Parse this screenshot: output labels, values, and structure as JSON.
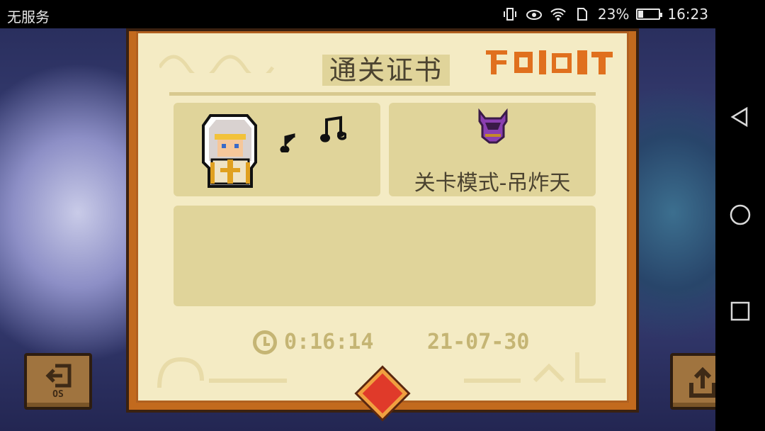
{
  "status_bar": {
    "carrier": "无服务",
    "battery_percent": "23%",
    "battery_level": 0.23,
    "time": "16:23",
    "icons": [
      "vibrate-icon",
      "eye-icon",
      "wifi-icon",
      "sim-icon",
      "battery-icon"
    ]
  },
  "certificate": {
    "title": "通关证书",
    "mode": "关卡模式-吊炸天",
    "time": "0:16:14",
    "date": "21-07-30"
  },
  "buttons": {
    "exit_sub": "OS"
  },
  "nav_bar": {
    "icons": [
      "back-icon",
      "home-icon",
      "recents-icon"
    ]
  },
  "colors": {
    "parchment": "#f4ebc4",
    "panel": "#e0d49a",
    "frame": "#c26a1e",
    "gem": "#e03a2a"
  }
}
